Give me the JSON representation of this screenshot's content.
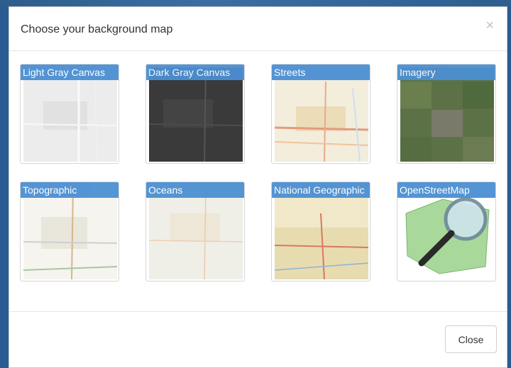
{
  "modal": {
    "title": "Choose your background map",
    "close_icon": "×",
    "close_button": "Close"
  },
  "basemaps": [
    {
      "label": "Light Gray Canvas"
    },
    {
      "label": "Dark Gray Canvas"
    },
    {
      "label": "Streets"
    },
    {
      "label": "Imagery"
    },
    {
      "label": "Topographic"
    },
    {
      "label": "Oceans"
    },
    {
      "label": "National Geographic"
    },
    {
      "label": "OpenStreetMap"
    }
  ],
  "colors": {
    "accent": "#4b8fd2",
    "backdrop": "#2a5c93"
  }
}
